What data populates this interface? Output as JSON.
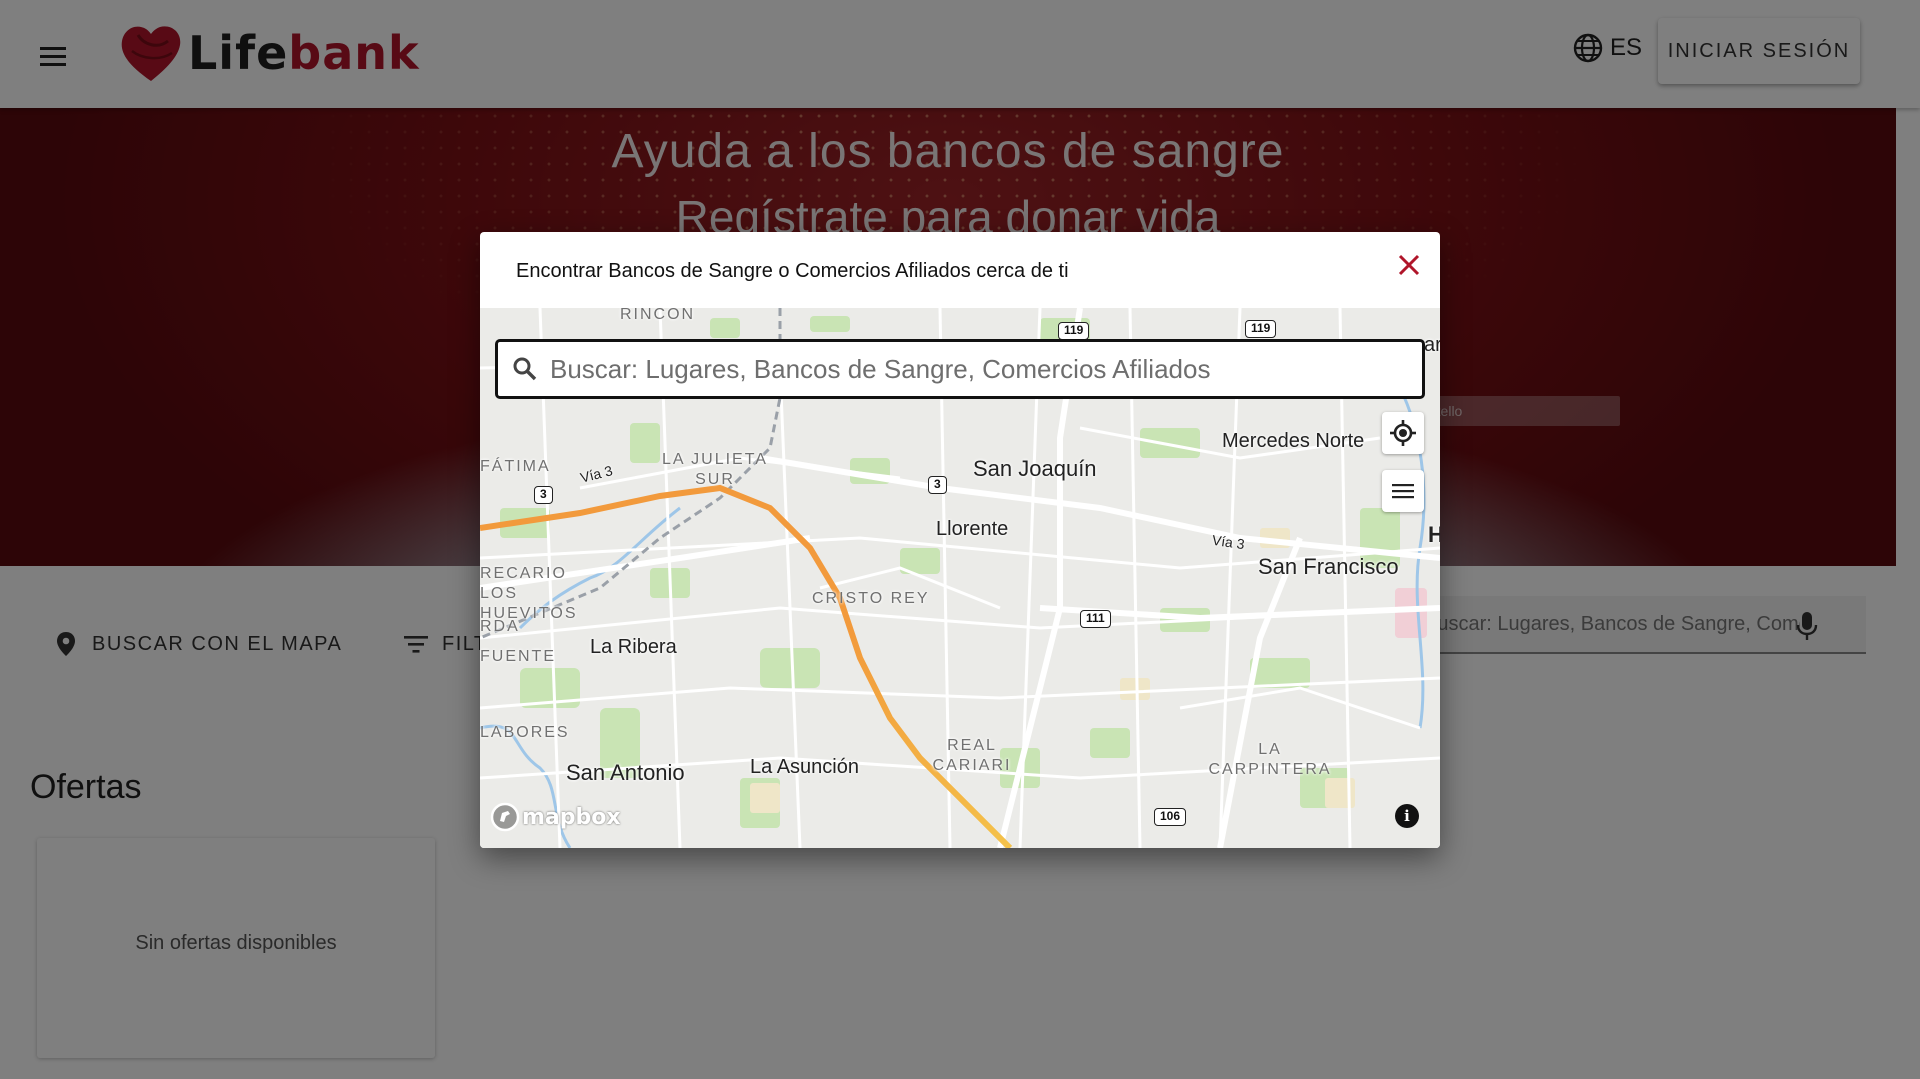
{
  "header": {
    "logo_life": "Life",
    "logo_bank": "bank",
    "language": "ES",
    "login_label": "INICIAR SESIÓN"
  },
  "hero": {
    "title": "Ayuda a los bancos de sangre",
    "subtitle": "Regístrate para donar vida",
    "bar_text": "rtello"
  },
  "toolbar": {
    "search_map_label": "BUSCAR CON EL MAPA",
    "filter_label": "FILTRAR",
    "search_placeholder": "Buscar: Lugares, Bancos de Sangre, Comercios Afiliados"
  },
  "offers": {
    "title": "Ofertas",
    "empty_text": "Sin ofertas disponibles"
  },
  "modal": {
    "title": "Encontrar Bancos de Sangre o Comercios Afiliados cerca de ti",
    "search_placeholder": "Buscar: Lugares, Bancos de Sangre, Comercios Afiliados",
    "attribution": "mapbox"
  },
  "map": {
    "places": [
      "San Joaquín",
      "Mercedes Norte",
      "San Francisco",
      "Llorente",
      "La Ribera",
      "San Antonio",
      "La Asunción",
      "Vía 3",
      "Vía 3"
    ],
    "districts": [
      "RINCÓN",
      "FÁTIMA",
      "LA JULIETA SUR",
      "CRISTO REY",
      "RECARIO LOS HUEVITOS",
      "RDA",
      "FUENTE",
      "LABORES",
      "REAL CARIARI",
      "LA CARPINTERA"
    ],
    "routes": [
      "119",
      "119",
      "3",
      "3",
      "111",
      "106"
    ],
    "edge_text": [
      "ar",
      "H"
    ]
  },
  "colors": {
    "brand_red": "#b0152a",
    "highway_orange": "#f4a040",
    "park_green": "#c9e4b4"
  }
}
